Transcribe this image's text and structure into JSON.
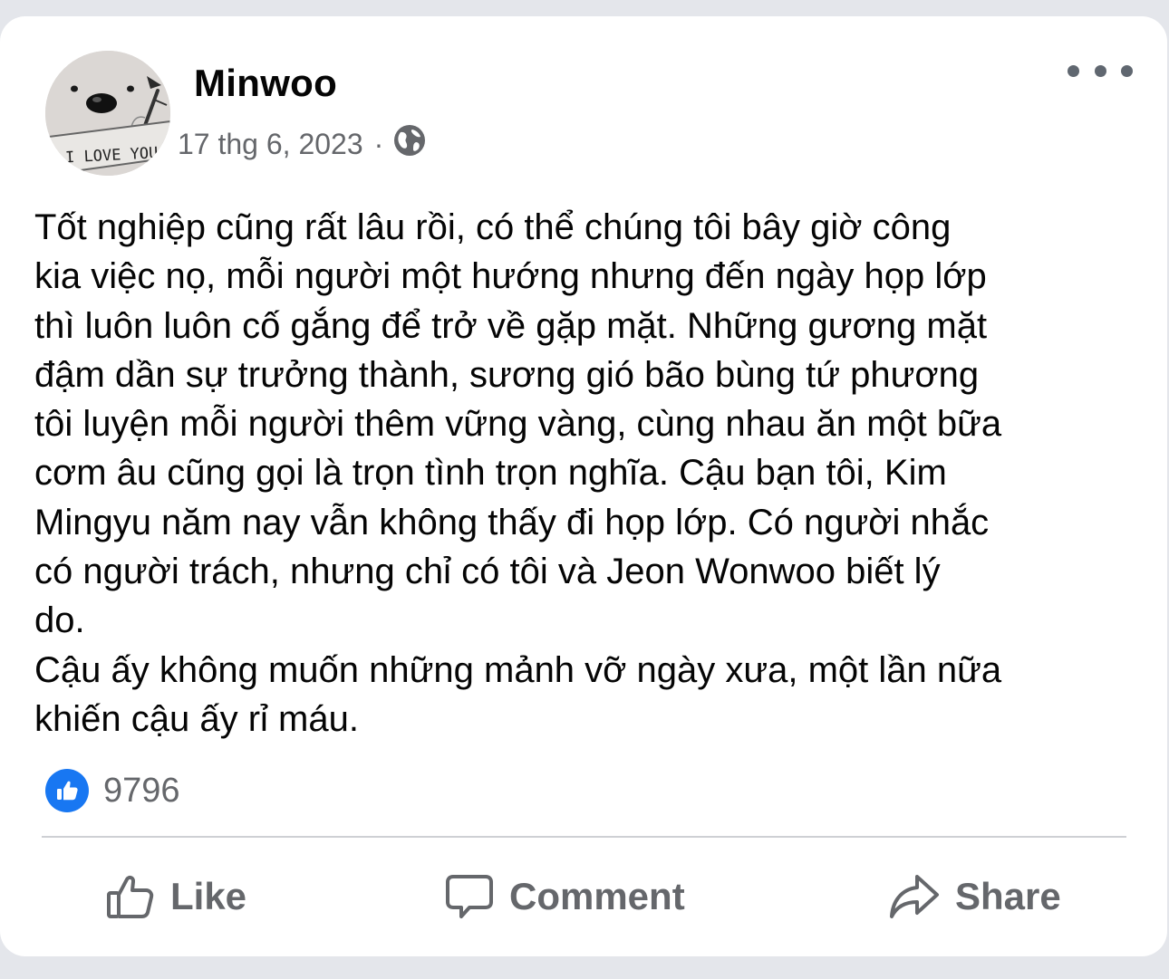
{
  "post": {
    "author": "Minwoo",
    "avatar_caption": "I LOVE YOU",
    "date": "17 thg 6, 2023",
    "separator": "·",
    "privacy_icon": "globe-icon",
    "body": "Tốt nghiệp cũng rất lâu rồi, có thể chúng tôi bây giờ công\nkia việc nọ, mỗi người một hướng nhưng đến ngày họp lớp\nthì luôn luôn cố gắng để trở về gặp mặt. Những gương mặt\nđậm dần sự trưởng thành, sương gió bão bùng tứ phương\ntôi luyện mỗi người thêm vững vàng, cùng nhau ăn một bữa\ncơm âu cũng gọi là trọn tình trọn nghĩa. Cậu bạn tôi, Kim\nMingyu năm nay vẫn không thấy đi họp lớp. Có người nhắc\ncó người trách, nhưng chỉ có tôi và Jeon Wonwoo biết lý\ndo.\nCậu ấy không muốn những mảnh vỡ ngày xưa, một lần nữa\nkhiến cậu ấy rỉ máu."
  },
  "reactions": {
    "icon": "thumbs-up-icon",
    "count": "9796"
  },
  "actions": {
    "like_label": "Like",
    "comment_label": "Comment",
    "share_label": "Share"
  },
  "colors": {
    "accent": "#1877f2",
    "secondary_text": "#65676b",
    "primary_text": "#050505",
    "background": "#e4e6eb"
  }
}
